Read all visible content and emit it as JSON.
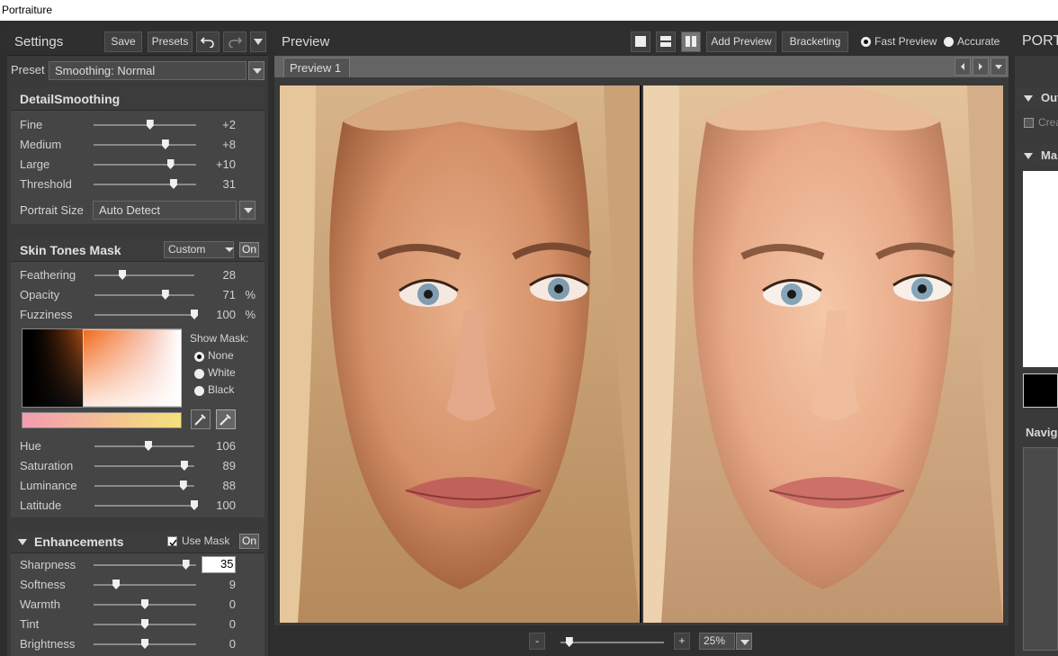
{
  "window": {
    "title": "Portraiture"
  },
  "settings": {
    "title": "Settings",
    "save_label": "Save",
    "presets_label": "Presets",
    "preset_label": "Preset",
    "preset_value": "Smoothing: Normal"
  },
  "detail_smoothing": {
    "title": "DetailSmoothing",
    "sliders": [
      {
        "label": "Fine",
        "value": "+2",
        "level": 0.55
      },
      {
        "label": "Medium",
        "value": "+8",
        "level": 0.7
      },
      {
        "label": "Large",
        "value": "+10",
        "level": 0.75
      },
      {
        "label": "Threshold",
        "value": "31",
        "level": 0.78
      }
    ],
    "portrait_size_label": "Portrait Size",
    "portrait_size_value": "Auto Detect"
  },
  "skin_tones_mask": {
    "title": "Skin Tones Mask",
    "mode_value": "Custom",
    "on_label": "On",
    "sliders": [
      {
        "label": "Feathering",
        "value": "28",
        "unit": "",
        "level": 0.28
      },
      {
        "label": "Opacity",
        "value": "71",
        "unit": "%",
        "level": 0.71
      },
      {
        "label": "Fuzziness",
        "value": "100",
        "unit": "%",
        "level": 1.0
      }
    ],
    "show_mask_label": "Show Mask:",
    "mask_options": [
      {
        "label": "None",
        "selected": true
      },
      {
        "label": "White",
        "selected": false
      },
      {
        "label": "Black",
        "selected": false
      }
    ],
    "color_sliders": [
      {
        "label": "Hue",
        "value": "106",
        "level": 0.54
      },
      {
        "label": "Saturation",
        "value": "89",
        "level": 0.9
      },
      {
        "label": "Luminance",
        "value": "88",
        "level": 0.89
      },
      {
        "label": "Latitude",
        "value": "100",
        "level": 1.0
      }
    ]
  },
  "enhancements": {
    "title": "Enhancements",
    "use_mask_label": "Use Mask",
    "use_mask_checked": true,
    "on_label": "On",
    "sliders": [
      {
        "label": "Sharpness",
        "value": "35",
        "level": 0.9,
        "editing": true
      },
      {
        "label": "Softness",
        "value": "9",
        "level": 0.22
      },
      {
        "label": "Warmth",
        "value": "0",
        "level": 0.5
      },
      {
        "label": "Tint",
        "value": "0",
        "level": 0.5
      },
      {
        "label": "Brightness",
        "value": "0",
        "level": 0.5
      }
    ]
  },
  "preview": {
    "title": "Preview",
    "add_preview_label": "Add Preview",
    "bracketing_label": "Bracketing",
    "fast_preview_label": "Fast Preview",
    "accurate_label": "Accurate",
    "tab_label": "Preview 1",
    "zoom_minus": "-",
    "zoom_plus": "+",
    "zoom_value": "25%",
    "zoom_level": 0.05
  },
  "right_panel": {
    "title": "PORTI",
    "output_label": "Out",
    "create_label": "Crea",
    "mask_label": "Ma",
    "navigator_label": "Navig"
  },
  "colors": {
    "accent_orange": "#f26a1b",
    "ramp_start": "#f49bb0",
    "ramp_end": "#f4e27a"
  }
}
